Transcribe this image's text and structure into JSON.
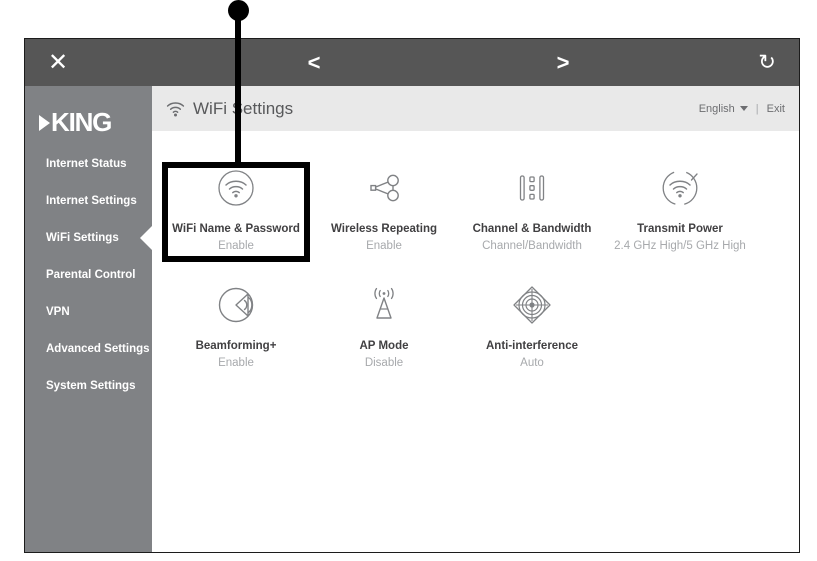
{
  "toolbar": {
    "close_label": "✕",
    "back_label": "<",
    "forward_label": ">",
    "refresh_label": "↻"
  },
  "sidebar": {
    "logo_text": "KING",
    "items": [
      {
        "label": "Internet Status",
        "active": false
      },
      {
        "label": "Internet Settings",
        "active": false
      },
      {
        "label": "WiFi Settings",
        "active": true
      },
      {
        "label": "Parental Control",
        "active": false
      },
      {
        "label": "VPN",
        "active": false
      },
      {
        "label": "Advanced Settings",
        "active": false
      },
      {
        "label": "System Settings",
        "active": false
      }
    ]
  },
  "header": {
    "title": "WiFi Settings",
    "language": "English",
    "separator": "|",
    "exit_label": "Exit"
  },
  "tiles": {
    "row1": [
      {
        "label": "WiFi Name & Password",
        "value": "Enable",
        "icon": "wifi-circle-icon",
        "highlighted": true
      },
      {
        "label": "Wireless Repeating",
        "value": "Enable",
        "icon": "share-nodes-icon",
        "highlighted": false
      },
      {
        "label": "Channel & Bandwidth",
        "value": "Channel/Bandwidth",
        "icon": "channel-bars-icon",
        "highlighted": false
      },
      {
        "label": "Transmit Power",
        "value": "2.4 GHz High/5 GHz High",
        "icon": "transmit-power-icon",
        "highlighted": false
      }
    ],
    "row2": [
      {
        "label": "Beamforming+",
        "value": "Enable",
        "icon": "beamforming-icon",
        "highlighted": false
      },
      {
        "label": "AP Mode",
        "value": "Disable",
        "icon": "antenna-tower-icon",
        "highlighted": false
      },
      {
        "label": "Anti-interference",
        "value": "Auto",
        "icon": "radar-target-icon",
        "highlighted": false
      }
    ]
  },
  "colors": {
    "toolbar": "#565656",
    "sidebar": "#808285",
    "header": "#e9e9e9",
    "label": "#414042",
    "value": "#a7a9ac",
    "callout": "#000000"
  }
}
